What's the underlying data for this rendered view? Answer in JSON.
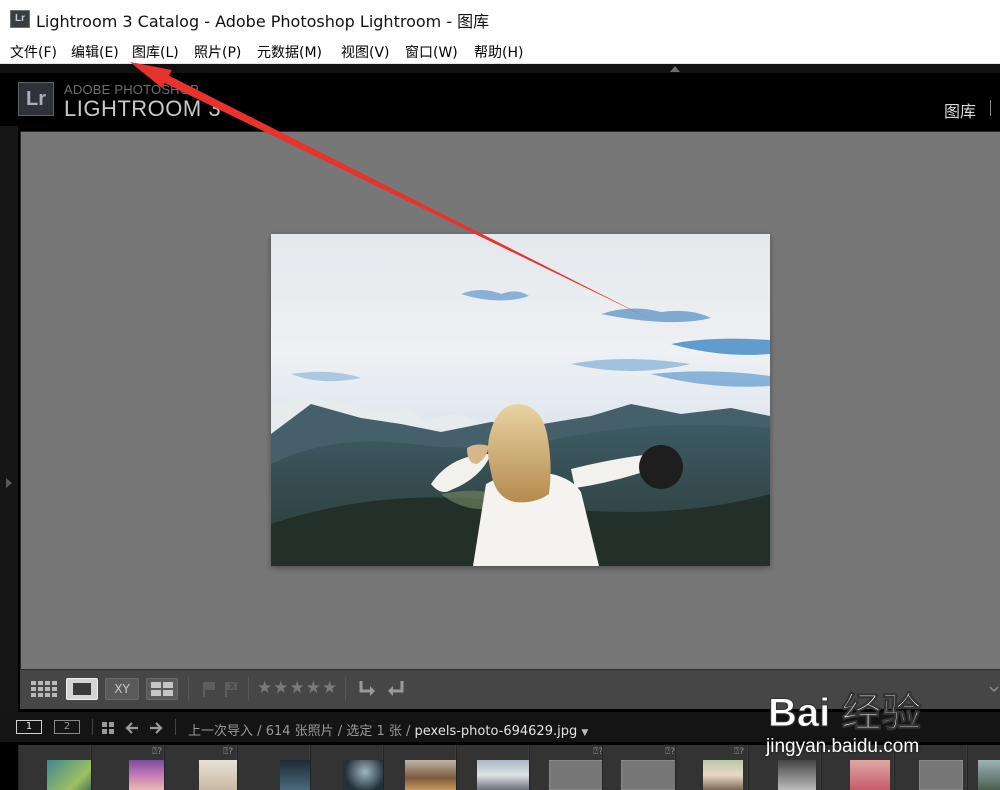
{
  "window": {
    "icon_label": "Lr",
    "title": "Lightroom 3 Catalog - Adobe Photoshop Lightroom - 图库"
  },
  "menu": [
    "文件(F)",
    "编辑(E)",
    "图库(L)",
    "照片(P)",
    "元数据(M)",
    "视图(V)",
    "窗口(W)",
    "帮助(H)"
  ],
  "identity": {
    "badge": "Lr",
    "adobe": "ADOBE PHOTOSHOP",
    "product": "LIGHTROOM 3"
  },
  "modules": {
    "active": "图库"
  },
  "toolbar": {
    "compare_label": "XY",
    "rating_stars": "★★★★★"
  },
  "filmstrip_bar": {
    "screen1": "1",
    "screen2": "2",
    "source": "上一次导入",
    "count": "614 张照片",
    "selected": "选定 1 张",
    "filename": "pexels-photo-694629.jpg"
  },
  "watermark": {
    "brand": "Bai 经验",
    "url": "jingyan.baidu.com"
  },
  "colors": {
    "annotation_arrow": "#e8322c",
    "panel_bg": "#777777",
    "chrome_bg": "#000000"
  }
}
